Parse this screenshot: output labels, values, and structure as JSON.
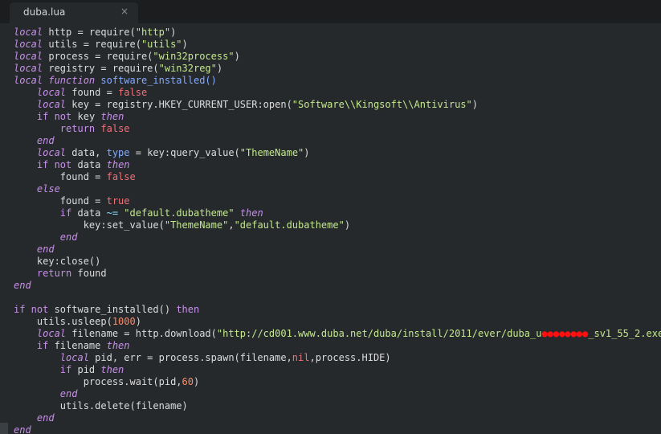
{
  "tab": {
    "title": "duba.lua",
    "close_icon": "×"
  },
  "code": {
    "lines": [
      [
        [
          "k",
          "local"
        ],
        [
          "t",
          " http = require("
        ],
        [
          "s",
          "\"http\""
        ],
        [
          "t",
          ")"
        ]
      ],
      [
        [
          "k",
          "local"
        ],
        [
          "t",
          " utils = require("
        ],
        [
          "s",
          "\"utils\""
        ],
        [
          "t",
          ")"
        ]
      ],
      [
        [
          "k",
          "local"
        ],
        [
          "t",
          " process = require("
        ],
        [
          "s",
          "\"win32process\""
        ],
        [
          "t",
          ")"
        ]
      ],
      [
        [
          "k",
          "local"
        ],
        [
          "t",
          " registry = require("
        ],
        [
          "s",
          "\"win32reg\""
        ],
        [
          "t",
          ")"
        ]
      ],
      [
        [
          "k",
          "local"
        ],
        [
          "t",
          " "
        ],
        [
          "k",
          "function"
        ],
        [
          "t",
          " "
        ],
        [
          "f",
          "software_installed()"
        ]
      ],
      [
        [
          "t",
          "    "
        ],
        [
          "k",
          "local"
        ],
        [
          "t",
          " found = "
        ],
        [
          "c",
          "false"
        ]
      ],
      [
        [
          "t",
          "    "
        ],
        [
          "k",
          "local"
        ],
        [
          "t",
          " key = registry.HKEY_CURRENT_USER:open("
        ],
        [
          "s",
          "\"Software\\\\Kingsoft\\\\Antivirus\""
        ],
        [
          "t",
          ")"
        ]
      ],
      [
        [
          "t",
          "    "
        ],
        [
          "kw",
          "if not"
        ],
        [
          "t",
          " key "
        ],
        [
          "k",
          "then"
        ]
      ],
      [
        [
          "t",
          "        "
        ],
        [
          "kw",
          "return"
        ],
        [
          "t",
          " "
        ],
        [
          "c",
          "false"
        ]
      ],
      [
        [
          "t",
          "    "
        ],
        [
          "k",
          "end"
        ]
      ],
      [
        [
          "t",
          "    "
        ],
        [
          "k",
          "local"
        ],
        [
          "t",
          " data, "
        ],
        [
          "f",
          "type"
        ],
        [
          "t",
          " = key:query_value("
        ],
        [
          "s",
          "\"ThemeName\""
        ],
        [
          "t",
          ")"
        ]
      ],
      [
        [
          "t",
          "    "
        ],
        [
          "kw",
          "if not"
        ],
        [
          "t",
          " data "
        ],
        [
          "k",
          "then"
        ]
      ],
      [
        [
          "t",
          "        found = "
        ],
        [
          "c",
          "false"
        ]
      ],
      [
        [
          "t",
          "    "
        ],
        [
          "k",
          "else"
        ]
      ],
      [
        [
          "t",
          "        found = "
        ],
        [
          "c",
          "true"
        ]
      ],
      [
        [
          "t",
          "        "
        ],
        [
          "kw",
          "if"
        ],
        [
          "t",
          " data "
        ],
        [
          "p",
          "~="
        ],
        [
          "t",
          " "
        ],
        [
          "s",
          "\"default.dubatheme\""
        ],
        [
          "t",
          " "
        ],
        [
          "k",
          "then"
        ]
      ],
      [
        [
          "t",
          "            key:set_value("
        ],
        [
          "s",
          "\"ThemeName\""
        ],
        [
          "t",
          ","
        ],
        [
          "s",
          "\"default.dubatheme\""
        ],
        [
          "t",
          ")"
        ]
      ],
      [
        [
          "t",
          "        "
        ],
        [
          "k",
          "end"
        ]
      ],
      [
        [
          "t",
          "    "
        ],
        [
          "k",
          "end"
        ]
      ],
      [
        [
          "t",
          "    key:close()"
        ]
      ],
      [
        [
          "t",
          "    "
        ],
        [
          "kw",
          "return"
        ],
        [
          "t",
          " found"
        ]
      ],
      [
        [
          "k",
          "end"
        ]
      ],
      [
        [
          "t",
          ""
        ]
      ],
      [
        [
          "kw",
          "if not"
        ],
        [
          "t",
          " software_installed() "
        ],
        [
          "kw",
          "then"
        ]
      ],
      [
        [
          "t",
          "    utils.usleep("
        ],
        [
          "n",
          "1000"
        ],
        [
          "t",
          ")"
        ]
      ],
      [
        [
          "t",
          "    "
        ],
        [
          "k",
          "local"
        ],
        [
          "t",
          " filename = http.download("
        ],
        [
          "s",
          "\"http://cd001.www.duba.net/duba/install/2011/ever/duba_u"
        ],
        [
          "redact",
          "●●●●●●●●"
        ],
        [
          "s",
          "_sv1_55_2.exe\""
        ],
        [
          "t",
          ")"
        ]
      ],
      [
        [
          "t",
          "    "
        ],
        [
          "kw",
          "if"
        ],
        [
          "t",
          " filename "
        ],
        [
          "k",
          "then"
        ]
      ],
      [
        [
          "t",
          "        "
        ],
        [
          "k",
          "local"
        ],
        [
          "t",
          " pid, err = process.spawn(filename,"
        ],
        [
          "c",
          "nil"
        ],
        [
          "t",
          ",process.HIDE)"
        ]
      ],
      [
        [
          "t",
          "        "
        ],
        [
          "kw",
          "if"
        ],
        [
          "t",
          " pid "
        ],
        [
          "k",
          "then"
        ]
      ],
      [
        [
          "t",
          "            process.wait(pid,"
        ],
        [
          "n",
          "60"
        ],
        [
          "t",
          ")"
        ]
      ],
      [
        [
          "t",
          "        "
        ],
        [
          "k",
          "end"
        ]
      ],
      [
        [
          "t",
          "        utils.delete(filename)"
        ]
      ],
      [
        [
          "t",
          "    "
        ],
        [
          "k",
          "end"
        ]
      ],
      [
        [
          "k",
          "end"
        ]
      ]
    ]
  }
}
